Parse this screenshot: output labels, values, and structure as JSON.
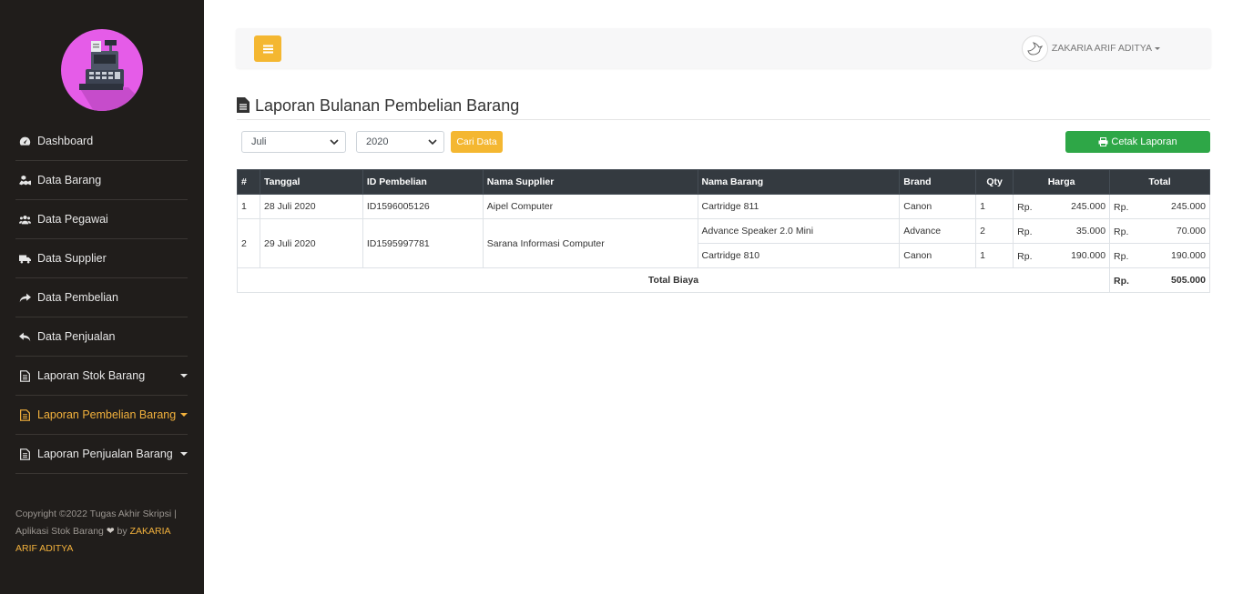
{
  "sidebar": {
    "items": [
      {
        "label": "Dashboard",
        "icon": "tachometer-icon",
        "active": false,
        "dropdown": false
      },
      {
        "label": "Data Barang",
        "icon": "cubes-icon",
        "active": false,
        "dropdown": false
      },
      {
        "label": "Data Pegawai",
        "icon": "users-icon",
        "active": false,
        "dropdown": false
      },
      {
        "label": "Data Supplier",
        "icon": "truck-icon",
        "active": false,
        "dropdown": false
      },
      {
        "label": "Data Pembelian",
        "icon": "share-icon",
        "active": false,
        "dropdown": false
      },
      {
        "label": "Data Penjualan",
        "icon": "reply-icon",
        "active": false,
        "dropdown": false
      },
      {
        "label": "Laporan Stok Barang",
        "icon": "file-text-icon",
        "active": false,
        "dropdown": true
      },
      {
        "label": "Laporan Pembelian Barang",
        "icon": "file-text-icon",
        "active": true,
        "dropdown": true
      },
      {
        "label": "Laporan Penjualan Barang",
        "icon": "file-text-icon",
        "active": false,
        "dropdown": true
      }
    ],
    "footer": {
      "line1": "Copyright ©2022 Tugas Akhir Skripsi |",
      "line2_prefix": "Aplikasi Stok Barang",
      "line2_by": " by ",
      "author": "ZAKARIA ARIF ADITYA"
    }
  },
  "topbar": {
    "user_name": "ZAKARIA ARIF ADITYA"
  },
  "page": {
    "title": "Laporan Bulanan Pembelian Barang"
  },
  "filters": {
    "month": "Juli",
    "year": "2020",
    "search_label": "Cari Data",
    "print_label": "Cetak Laporan"
  },
  "table": {
    "headers": [
      "#",
      "Tanggal",
      "ID Pembelian",
      "Nama Supplier",
      "Nama Barang",
      "Brand",
      "Qty",
      "Harga",
      "Total"
    ],
    "currency": "Rp.",
    "rows": [
      {
        "no": "1",
        "tanggal": "28 Juli 2020",
        "id": "ID1596005126",
        "supplier": "Aipel Computer",
        "items": [
          {
            "nama": "Cartridge 811",
            "brand": "Canon",
            "qty": "1",
            "harga": "245.000",
            "total": "245.000"
          }
        ]
      },
      {
        "no": "2",
        "tanggal": "29 Juli 2020",
        "id": "ID1595997781",
        "supplier": "Sarana Informasi Computer",
        "items": [
          {
            "nama": "Advance Speaker 2.0 Mini",
            "brand": "Advance",
            "qty": "2",
            "harga": "35.000",
            "total": "70.000"
          },
          {
            "nama": "Cartridge 810",
            "brand": "Canon",
            "qty": "1",
            "harga": "190.000",
            "total": "190.000"
          }
        ]
      }
    ],
    "total_label": "Total Biaya",
    "total_value": "505.000"
  },
  "colors": {
    "sidebar_bg": "#201d1b",
    "accent": "#f2b13c",
    "logo_bg": "#e55ce8",
    "print_button": "#2ea747",
    "table_header": "#343a40"
  }
}
